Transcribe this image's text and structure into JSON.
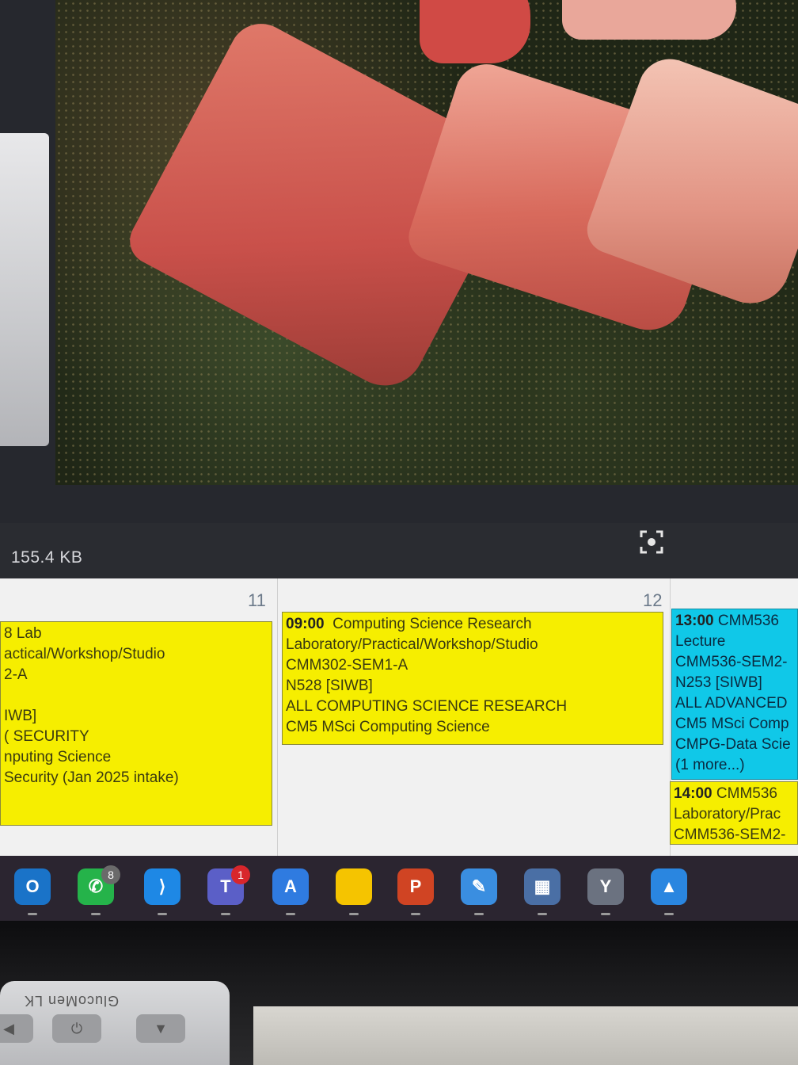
{
  "viewer": {
    "file_size": "155.4 KB",
    "fullscreen_icon": "fullscreen-icon"
  },
  "calendar": {
    "days": [
      {
        "number": "11"
      },
      {
        "number": "12"
      }
    ],
    "events": {
      "day11_lab": {
        "lines": [
          "8 Lab",
          "actical/Workshop/Studio",
          "2-A",
          "",
          "IWB]",
          "( SECURITY",
          "nputing Science",
          "Security (Jan 2025 intake)"
        ]
      },
      "day12_research": {
        "time": "09:00",
        "title": "Computing Science Research",
        "lines": [
          "Laboratory/Practical/Workshop/Studio",
          "CMM302-SEM1-A",
          "N528 [SIWB]",
          "ALL COMPUTING SCIENCE RESEARCH",
          "CM5 MSci Computing Science"
        ]
      },
      "cmm536_lecture": {
        "time": "13:00",
        "title": "CMM536",
        "lines": [
          "Lecture",
          "CMM536-SEM2-",
          "N253 [SIWB]",
          "ALL ADVANCED",
          "CM5 MSci Comp",
          "CMPG-Data Scie",
          "(1 more...)"
        ]
      },
      "cmm536_lab": {
        "time": "14:00",
        "title": "CMM536",
        "lines": [
          "Laboratory/Prac",
          "CMM536-SEM2-"
        ]
      }
    }
  },
  "taskbar": {
    "items": [
      {
        "name": "outlook",
        "glyph": "O",
        "color": "#1a73c8",
        "badge": ""
      },
      {
        "name": "whatsapp",
        "glyph": "✆",
        "color": "#25b34a",
        "badge": "8"
      },
      {
        "name": "vscode",
        "glyph": "⟩",
        "color": "#1e88e5",
        "badge": ""
      },
      {
        "name": "teams",
        "glyph": "T",
        "color": "#5b5fc7",
        "badge": "1"
      },
      {
        "name": "app-store",
        "glyph": "A",
        "color": "#2f7be0",
        "badge": ""
      },
      {
        "name": "sticky-notes",
        "glyph": "",
        "color": "#f5c400",
        "badge": ""
      },
      {
        "name": "powerpoint",
        "glyph": "P",
        "color": "#d04423",
        "badge": ""
      },
      {
        "name": "snipping-tool",
        "glyph": "✎",
        "color": "#3a8ee0",
        "badge": ""
      },
      {
        "name": "calculator",
        "glyph": "▦",
        "color": "#4a6fa5",
        "badge": ""
      },
      {
        "name": "clock",
        "glyph": "Y",
        "color": "#6b7280",
        "badge": ""
      },
      {
        "name": "photos",
        "glyph": "▲",
        "color": "#2a86e0",
        "badge": ""
      }
    ]
  },
  "desk": {
    "device_label": "GlucoMen LK"
  }
}
